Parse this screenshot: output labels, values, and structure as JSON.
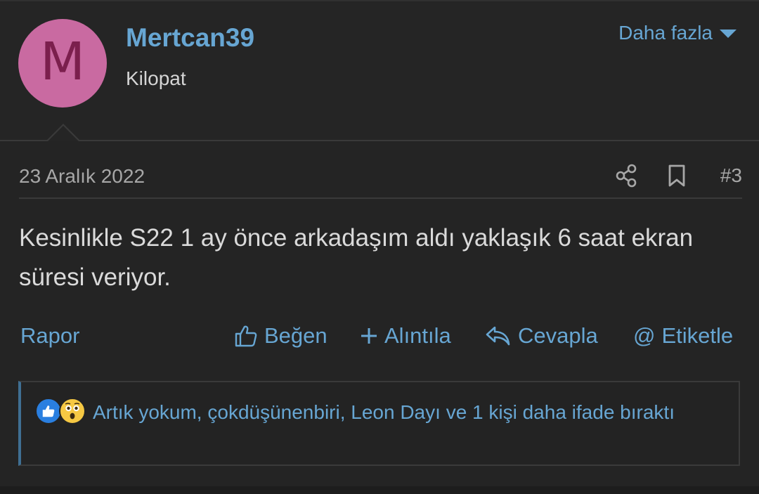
{
  "user": {
    "avatar_letter": "M",
    "avatar_color": "#c96aa1",
    "name": "Mertcan39",
    "title": "Kilopat"
  },
  "header": {
    "more_label": "Daha fazla"
  },
  "post": {
    "date": "23 Aralık 2022",
    "number": "#3",
    "body": "Kesinlikle S22 1 ay önce arkadaşım aldı yaklaşık 6 saat ekran süresi veriyor."
  },
  "actions": {
    "report": "Rapor",
    "like": "Beğen",
    "quote": "Alıntıla",
    "reply": "Cevapla",
    "tag": "Etiketle"
  },
  "reactions": {
    "icons": [
      "like-reaction",
      "wow-reaction"
    ],
    "summary": "Artık yokum, çokdüşünenbiri, Leon Dayı ve 1 kişi daha ifade bıraktı"
  },
  "colors": {
    "link": "#67a6d3",
    "background": "#252525",
    "accent_border": "#3f6f93"
  }
}
